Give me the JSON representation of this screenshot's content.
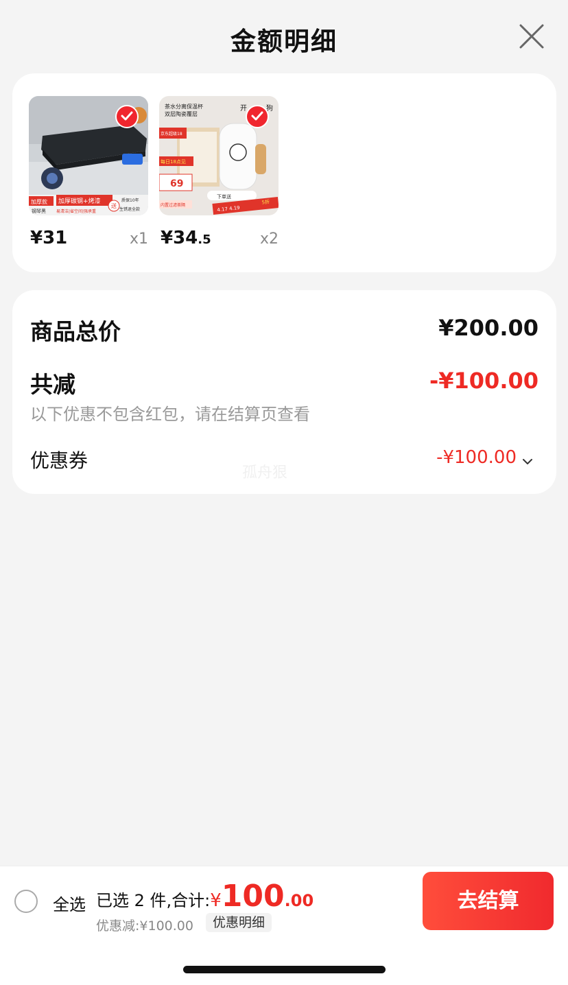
{
  "header": {
    "title": "金额明细"
  },
  "products": [
    {
      "price_main": "¥31",
      "price_decimal": "",
      "qty": "x1",
      "thumb_texts": [
        "加厚款",
        "钢琴黑",
        "加厚碳钢+烤漆",
        "易清洁|省空间|强承重",
        "送",
        "质保10年",
        "生锈退全款"
      ]
    },
    {
      "price_main": "¥34",
      "price_decimal": ".5",
      "qty": "x2",
      "thumb_texts": [
        "茶水分离保温杯",
        "双层陶瓷覆层",
        "开",
        "狗",
        "京东超级18",
        "每日18点见",
        "69",
        "内置过滤茶隔",
        "下单送",
        "4.17 4.19",
        "5折"
      ]
    }
  ],
  "summary": {
    "total_label": "商品总价",
    "total_value": "¥200.00",
    "reduce_label": "共减",
    "reduce_value": "-¥100.00",
    "note": "以下优惠不包含红包，请在结算页查看",
    "coupon_label": "优惠券",
    "coupon_value": "-¥100.00",
    "watermark": "孤舟狠"
  },
  "bottom_bar": {
    "select_all": "全选",
    "selected_text": "已选 2 件,合计:",
    "currency": "¥",
    "amount_int": "100",
    "amount_dec": ".00",
    "discount_text": "优惠减:¥100.00",
    "detail_chip": "优惠明细",
    "checkout": "去结算"
  },
  "colors": {
    "accent": "#ee2a24",
    "background": "#f4f4f4",
    "card": "#ffffff"
  },
  "icons": {
    "close": "close-icon",
    "check": "check-icon",
    "chevron": "chevron-down-icon"
  }
}
